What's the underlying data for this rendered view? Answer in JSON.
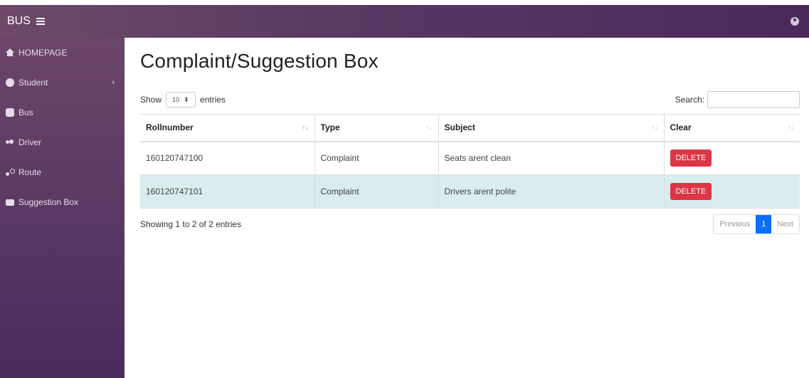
{
  "header": {
    "brand": "BUS"
  },
  "sidebar": {
    "items": [
      {
        "label": "HOMEPAGE"
      },
      {
        "label": "Student"
      },
      {
        "label": "Bus"
      },
      {
        "label": "Driver"
      },
      {
        "label": "Route"
      },
      {
        "label": "Suggestion Box"
      }
    ]
  },
  "main": {
    "title": "Complaint/Suggestion Box",
    "show_label": "Show",
    "entries_label": "entries",
    "page_length": "10",
    "search_label": "Search:",
    "columns": [
      "Rollnumber",
      "Type",
      "Subject",
      "Clear"
    ],
    "rows": [
      {
        "rollnumber": "160120747100",
        "type": "Complaint",
        "subject": "Seats arent clean",
        "action": "DELETE"
      },
      {
        "rollnumber": "160120747101",
        "type": "Complaint",
        "subject": "Drivers arent polite",
        "action": "DELETE"
      }
    ],
    "info": "Showing 1 to 2 of 2 entries",
    "pagination": {
      "previous": "Previous",
      "current": "1",
      "next": "Next"
    }
  },
  "colors": {
    "header_gradient_start": "#6e4a68",
    "header_gradient_end": "#4a2a5c",
    "delete_button": "#dc3545",
    "active_page": "#0d6efd",
    "striped_row": "#d9ecee"
  }
}
